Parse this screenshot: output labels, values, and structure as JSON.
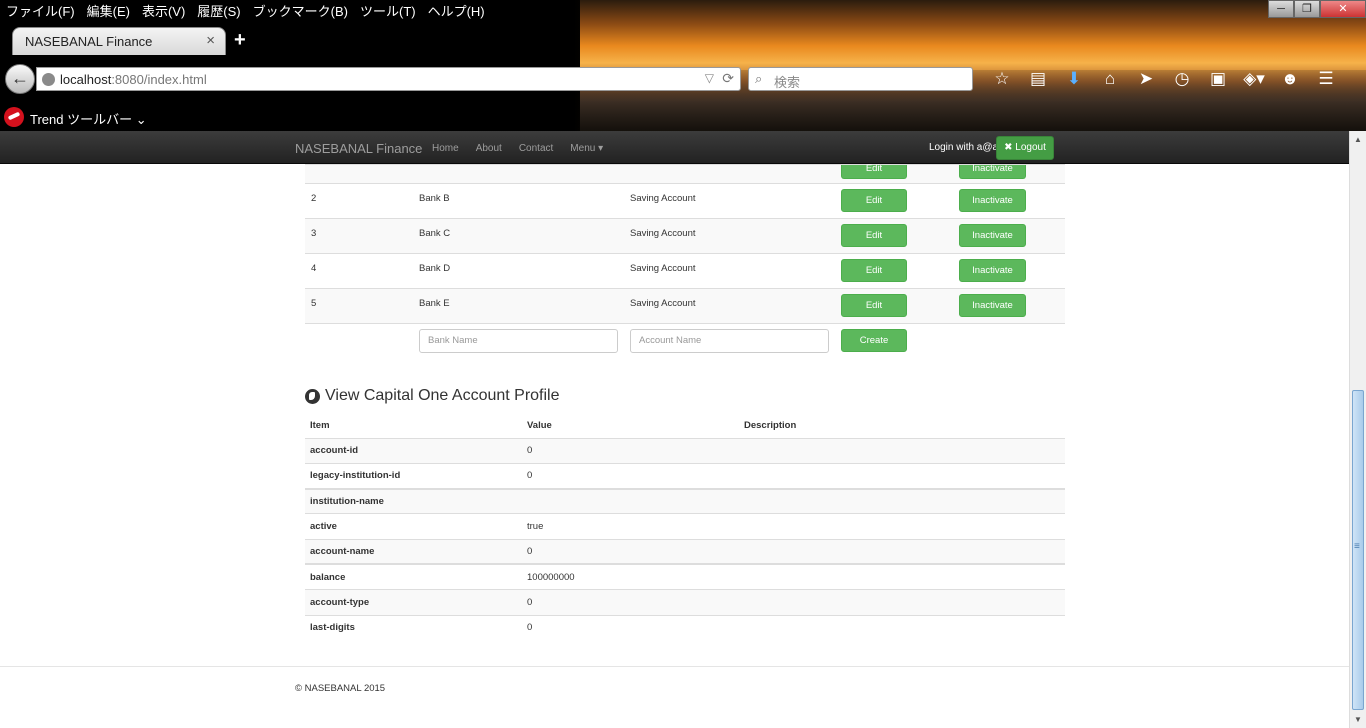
{
  "browser": {
    "menu": [
      "ファイル(F)",
      "編集(E)",
      "表示(V)",
      "履歴(S)",
      "ブックマーク(B)",
      "ツール(T)",
      "ヘルプ(H)"
    ],
    "tab_title": "NASEBANAL Finance",
    "tab_close": "×",
    "new_tab": "+",
    "url_host": "localhost",
    "url_rest": ":8080/index.html",
    "search_placeholder": "検索",
    "toolbar_label": "Trend ツールバー",
    "window_buttons": {
      "minimize": "─",
      "maximize": "❐",
      "close": "✕"
    }
  },
  "nav": {
    "brand": "NASEBANAL Finance",
    "links": [
      "Home",
      "About",
      "Contact",
      "Menu ▾"
    ],
    "login_text": "Login with a@a",
    "logout_label": "✖ Logout"
  },
  "banks": {
    "edit_label": "Edit",
    "inactivate_label": "Inactivate",
    "rows": [
      {
        "id": "2",
        "bank": "Bank B",
        "account": "Saving Account"
      },
      {
        "id": "3",
        "bank": "Bank C",
        "account": "Saving Account"
      },
      {
        "id": "4",
        "bank": "Bank D",
        "account": "Saving Account"
      },
      {
        "id": "5",
        "bank": "Bank E",
        "account": "Saving Account"
      }
    ],
    "bank_name_placeholder": "Bank Name",
    "account_name_placeholder": "Account Name",
    "create_label": "Create"
  },
  "profile": {
    "title": "View Capital One Account Profile",
    "headers": [
      "Item",
      "Value",
      "Description"
    ],
    "rows": [
      {
        "item": "account-id",
        "value": "0"
      },
      {
        "item": "legacy-institution-id",
        "value": "0"
      },
      {
        "item": "institution-name",
        "value": ""
      },
      {
        "item": "active",
        "value": "true"
      },
      {
        "item": "account-name",
        "value": "0"
      },
      {
        "item": "balance",
        "value": "100000000"
      },
      {
        "item": "account-type",
        "value": "0"
      },
      {
        "item": "last-digits",
        "value": "0"
      }
    ]
  },
  "footer": "© NASEBANAL 2015",
  "colors": {
    "button_green": "#5cb85c",
    "navbar": "#222222"
  }
}
